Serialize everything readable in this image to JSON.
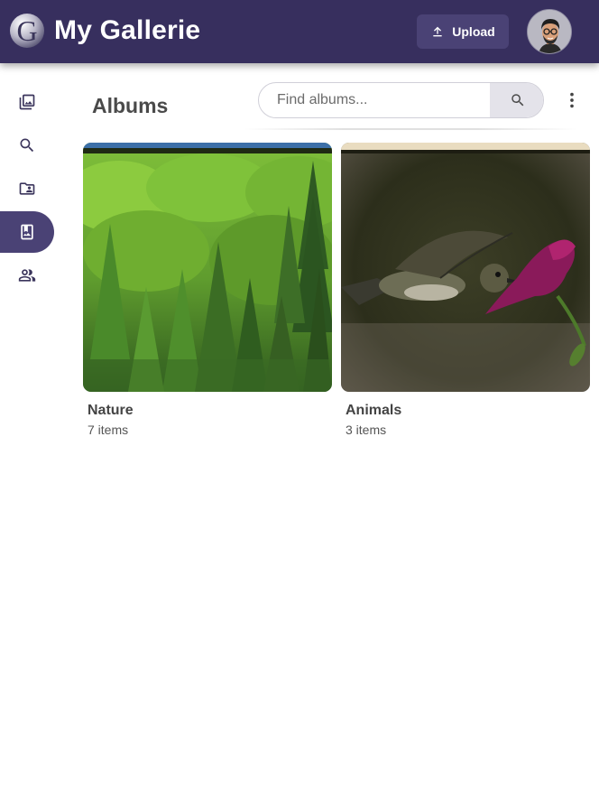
{
  "header": {
    "title": "My Gallerie",
    "logo_letter": "G",
    "upload_label": "Upload"
  },
  "sidebar": {
    "items": [
      {
        "name": "photos",
        "icon": "photo-library-icon",
        "active": false
      },
      {
        "name": "search",
        "icon": "search-icon",
        "active": false
      },
      {
        "name": "shared-folder",
        "icon": "folder-shared-icon",
        "active": false
      },
      {
        "name": "albums",
        "icon": "photo-album-icon",
        "active": true
      },
      {
        "name": "people",
        "icon": "people-icon",
        "active": false
      }
    ]
  },
  "main": {
    "title": "Albums",
    "search": {
      "placeholder": "Find albums...",
      "value": ""
    }
  },
  "albums": [
    {
      "name": "Nature",
      "count": "7 items"
    },
    {
      "name": "Animals",
      "count": "3 items"
    }
  ],
  "colors": {
    "primary": "#372f5e",
    "primary_light": "#4a4275",
    "search_button": "#e4e3ea"
  }
}
